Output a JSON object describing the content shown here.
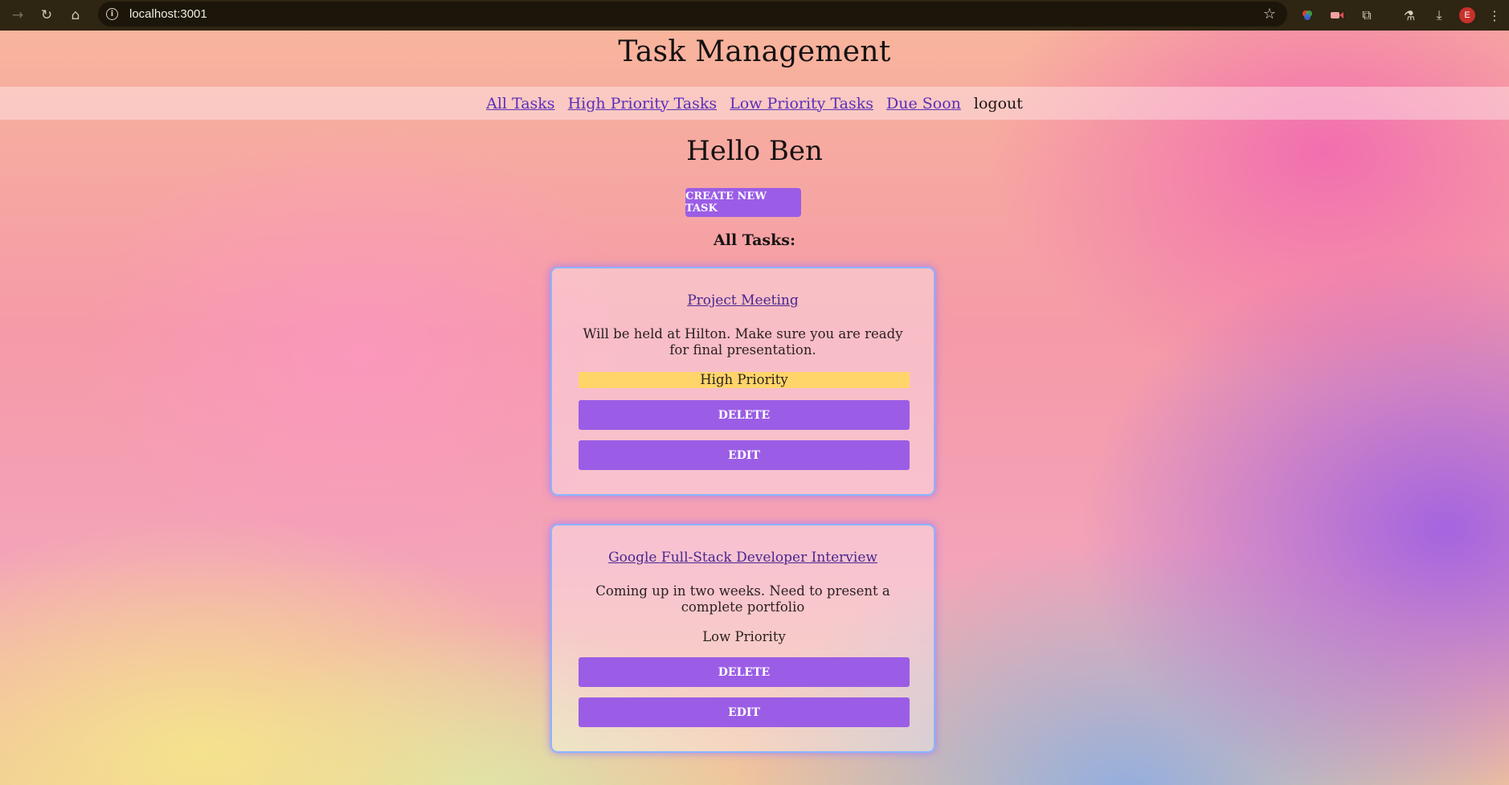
{
  "browser": {
    "url": "localhost:3001",
    "profile_initial": "E"
  },
  "header": {
    "title": "Task Management"
  },
  "nav": {
    "links": [
      "All Tasks",
      "High Priority Tasks",
      "Low Priority Tasks",
      "Due Soon"
    ],
    "logout": "logout"
  },
  "main": {
    "greeting": "Hello Ben",
    "create_button": "CREATE NEW TASK",
    "section_title": "All Tasks:",
    "tasks": [
      {
        "title": "Project Meeting",
        "description": "Will be held at Hilton. Make sure you are ready for final presentation.",
        "priority": "High Priority",
        "delete_label": "DELETE",
        "edit_label": "EDIT"
      },
      {
        "title": "Google Full-Stack Developer Interview",
        "description": "Coming up in two weeks. Need to present a complete portfolio",
        "priority": "Low Priority",
        "delete_label": "DELETE",
        "edit_label": "EDIT"
      }
    ]
  },
  "colors": {
    "accent": "#9b5de5",
    "high_priority": "#ffd56a",
    "link": "#5a2fb8",
    "card_border": "#8ab4ff"
  }
}
